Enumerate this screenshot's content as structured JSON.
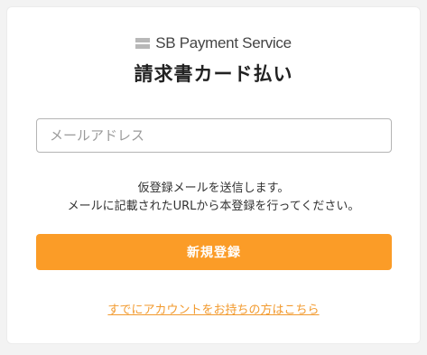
{
  "brand": {
    "name": "SB Payment Service",
    "icon": "brand-stripes-logo",
    "icon_color": "#b8b8b8"
  },
  "title": "請求書カード払い",
  "email_input": {
    "placeholder": "メールアドレス",
    "value": ""
  },
  "notice": {
    "line1": "仮登録メールを送信します。",
    "line2": "メールに記載されたURLから本登録を行ってください。"
  },
  "register_button": {
    "label": "新規登録",
    "color": "#fb9c27"
  },
  "login_link": {
    "label": "すでにアカウントをお持ちの方はこちら",
    "color": "#f29a2e"
  }
}
